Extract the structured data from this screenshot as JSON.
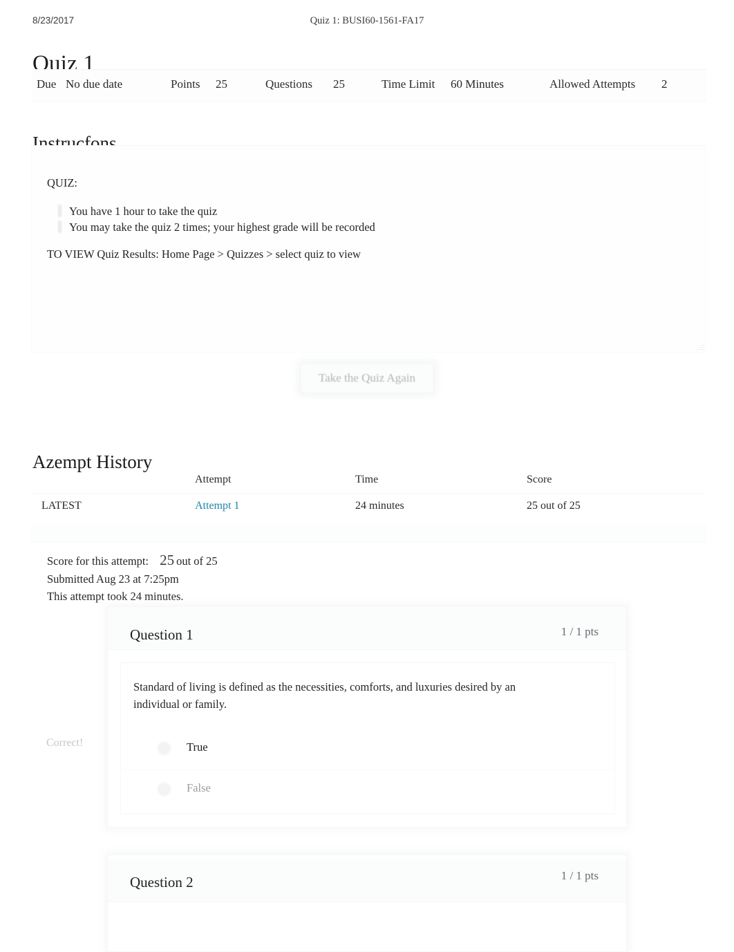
{
  "print_header": {
    "date": "8/23/2017",
    "document_title": "Quiz 1: BUSI60-1561-FA17"
  },
  "page_title": "Quiz 1",
  "quiz_details": {
    "due_label": "Due",
    "due_value": "No due date",
    "points_label": "Points",
    "points_value": "25",
    "questions_label": "Questions",
    "questions_value": "25",
    "time_limit_label": "Time Limit",
    "time_limit_value": "60 Minutes",
    "allowed_attempts_label": "Allowed Attempts",
    "allowed_attempts_value": "2"
  },
  "instructions": {
    "heading": "Instrucfons",
    "quiz_label": "QUIZ:",
    "bullets": [
      "You have 1 hour to take the quiz",
      "You may take the quiz 2 times; your highest grade will be recorded"
    ],
    "view_note": "TO VIEW Quiz Results: Home Page > Quizzes > select quiz to view"
  },
  "retake_button": {
    "label": "Take the Quiz Again"
  },
  "attempt_history": {
    "heading": "Azempt History",
    "columns": [
      "",
      "Attempt",
      "Time",
      "Score"
    ],
    "rows": [
      {
        "kept": "LATEST",
        "attempt": "Attempt 1",
        "time": "24 minutes",
        "score": "25 out of 25"
      }
    ]
  },
  "score_summary": {
    "score_label": "Score for this attempt:",
    "score_value": "25",
    "score_suffix": "out of 25",
    "submitted": "Submitted Aug 23 at 7:25pm",
    "duration": "This attempt took 24 minutes."
  },
  "questions": [
    {
      "name": "Question 1",
      "points": "1 / 1 pts",
      "verdict": "Correct!",
      "text": "Standard of living is defined as the necessities, comforts, and luxuries desired by an individual or family.",
      "answers": [
        {
          "label": "True",
          "selected": true
        },
        {
          "label": "False",
          "selected": false
        }
      ]
    },
    {
      "name": "Question 2",
      "points": "1 / 1 pts"
    }
  ],
  "colors": {
    "link": "#1c87a3",
    "text": "#262626",
    "muted": "#9a9ea1",
    "verdict": "#c3c6c8"
  }
}
